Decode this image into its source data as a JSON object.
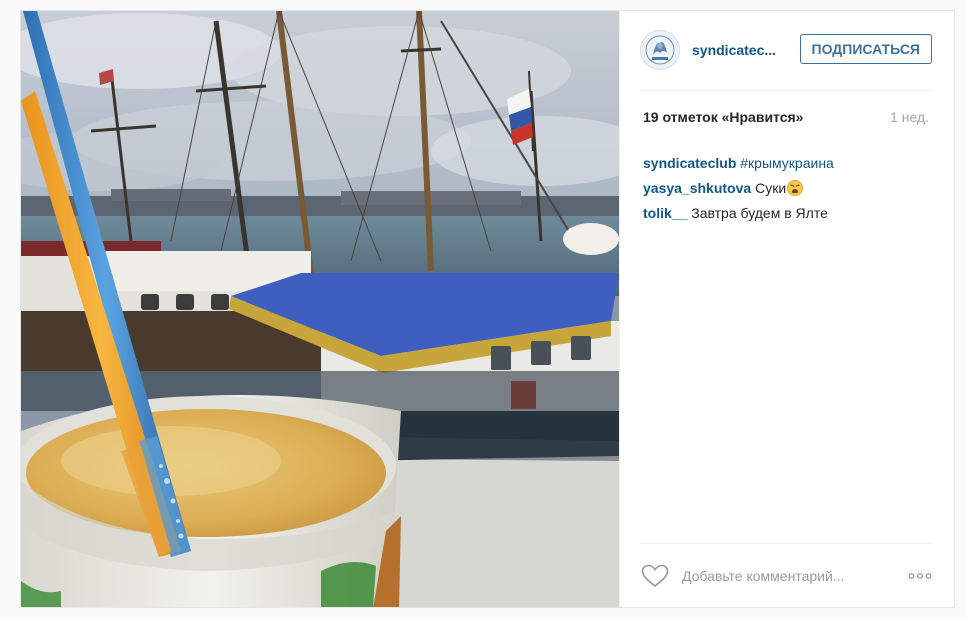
{
  "post": {
    "username": "syndicatec...",
    "follow_label": "ПОДПИСАТЬСЯ",
    "likes": "19 отметок «Нравится»",
    "time": "1 нед.",
    "comments": [
      {
        "user": "syndicateclub",
        "text": "#крымукраина"
      },
      {
        "user": "yasya_shkutova",
        "text": "Суки"
      },
      {
        "user": "tolik__",
        "text": "Завтра будем в Ялте"
      }
    ],
    "comment_placeholder": "Добавьте комментарий...",
    "icons": {
      "like": "heart-outline-icon",
      "more": "more-options-icon",
      "emoji": "weary-face-emoji"
    }
  },
  "colors": {
    "link": "#125688",
    "follow": "#3f729b",
    "muted": "#a5a7aa"
  }
}
